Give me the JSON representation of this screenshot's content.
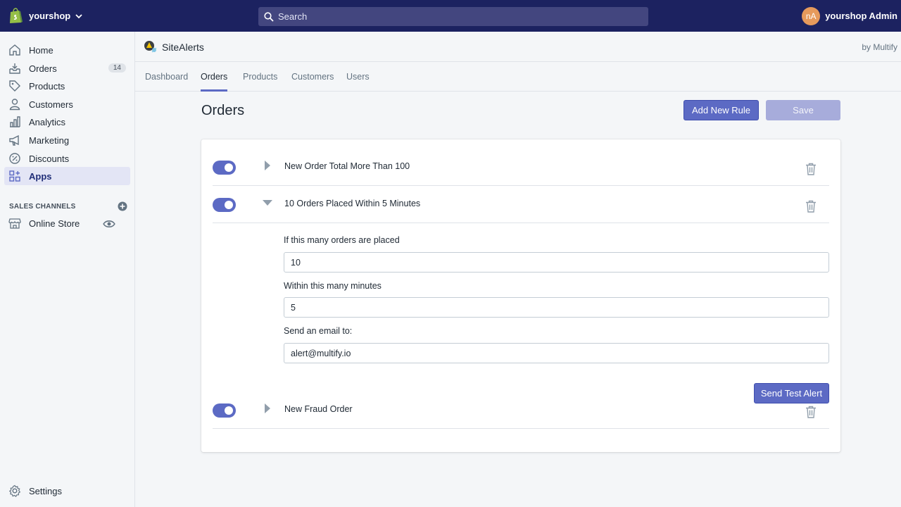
{
  "topbar": {
    "store_name": "yourshop",
    "search_placeholder": "Search",
    "avatar_initials": "nA",
    "user_name": "yourshop Admin"
  },
  "sidebar": {
    "items": [
      {
        "label": "Home",
        "icon": "home-icon"
      },
      {
        "label": "Orders",
        "icon": "orders-icon",
        "badge": "14"
      },
      {
        "label": "Products",
        "icon": "tag-icon"
      },
      {
        "label": "Customers",
        "icon": "person-icon"
      },
      {
        "label": "Analytics",
        "icon": "bar-chart-icon"
      },
      {
        "label": "Marketing",
        "icon": "megaphone-icon"
      },
      {
        "label": "Discounts",
        "icon": "discount-icon"
      },
      {
        "label": "Apps",
        "icon": "apps-icon",
        "active": true
      }
    ],
    "sales_channels_label": "SALES CHANNELS",
    "online_store_label": "Online Store",
    "settings_label": "Settings"
  },
  "app": {
    "name": "SiteAlerts",
    "by": "by Multify",
    "tabs": [
      "Dashboard",
      "Orders",
      "Products",
      "Customers",
      "Users"
    ],
    "active_tab": "Orders"
  },
  "main": {
    "title": "Orders",
    "add_rule_label": "Add New Rule",
    "save_label": "Save",
    "rules": [
      {
        "title": "New Order Total More Than 100",
        "enabled": true,
        "expanded": false
      },
      {
        "title": "10 Orders Placed Within 5 Minutes",
        "enabled": true,
        "expanded": true
      },
      {
        "title": "New Fraud Order",
        "enabled": true,
        "expanded": false
      }
    ],
    "form": {
      "orders_label": "If this many orders are placed",
      "orders_value": "10",
      "minutes_label": "Within this many minutes",
      "minutes_value": "5",
      "email_label": "Send an email to:",
      "email_value": "alert@multify.io",
      "test_alert_label": "Send Test Alert"
    }
  },
  "colors": {
    "topbar": "#1c2260",
    "accent": "#5c6ac4",
    "avatar": "#e69a5c"
  }
}
